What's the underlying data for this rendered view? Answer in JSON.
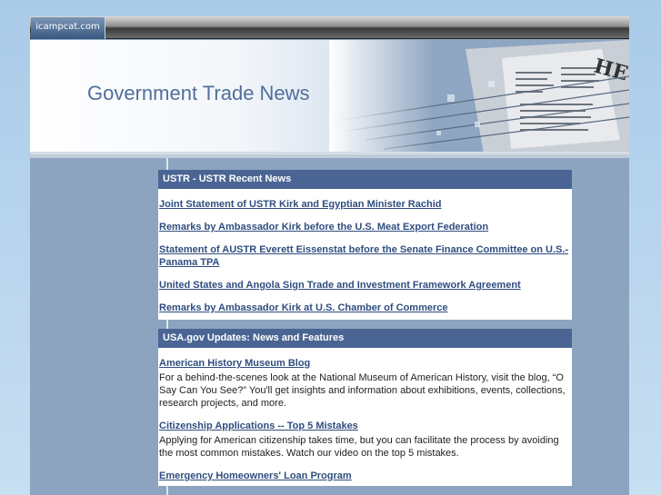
{
  "header": {
    "site_tab": "icampcat.com",
    "title": "Government Trade News"
  },
  "ustr": {
    "heading": "USTR - USTR Recent News",
    "links": [
      "Joint Statement of USTR Kirk and Egyptian Minister Rachid",
      "Remarks by Ambassador Kirk before the U.S. Meat Export Federation",
      "Statement of AUSTR Everett Eissenstat before the Senate Finance Committee on U.S.-Panama TPA",
      "United States and Angola Sign Trade and Investment Framework Agreement",
      "Remarks by Ambassador Kirk at U.S. Chamber of Commerce"
    ]
  },
  "usagov": {
    "heading": "USA.gov Updates: News and Features",
    "items": [
      {
        "title": "American History Museum Blog",
        "text": "For a behind-the-scenes look at the National Museum of American History, visit the blog, “O Say Can You See?” You'll get insights and information about exhibitions, events, collections, research projects, and more."
      },
      {
        "title": "Citizenship Applications -- Top 5 Mistakes",
        "text": "Applying for American citizenship takes time, but you can facilitate the process by avoiding the most common mistakes. Watch our video on the top 5 mistakes."
      },
      {
        "title": "Emergency Homeowners' Loan Program",
        "text": ""
      }
    ]
  },
  "colors": {
    "page_bg": "#8ca4bf",
    "box_header": "#4a6593",
    "link": "#2f4d7f",
    "title": "#4f6f99"
  }
}
